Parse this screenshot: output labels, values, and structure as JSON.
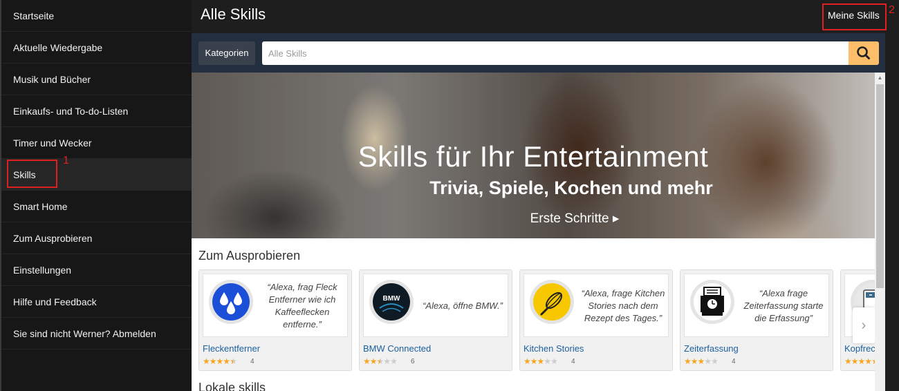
{
  "sidebar": {
    "items": [
      {
        "label": "Startseite"
      },
      {
        "label": "Aktuelle Wiedergabe"
      },
      {
        "label": "Musik und Bücher"
      },
      {
        "label": "Einkaufs- und To-do-Listen"
      },
      {
        "label": "Timer und Wecker"
      },
      {
        "label": "Skills",
        "active": true
      },
      {
        "label": "Smart Home"
      },
      {
        "label": "Zum Ausprobieren"
      },
      {
        "label": "Einstellungen"
      },
      {
        "label": "Hilfe und Feedback"
      },
      {
        "label": "Sie sind nicht Werner? Abmelden"
      }
    ]
  },
  "header": {
    "title": "Alle Skills",
    "my_skills": "Meine Skills"
  },
  "search": {
    "categories_label": "Kategorien",
    "placeholder": "Alle Skills"
  },
  "banner": {
    "title": "Skills für Ihr Entertainment",
    "subtitle": "Trivia, Spiele, Kochen und mehr",
    "cta": "Erste Schritte ▸"
  },
  "section": {
    "title": "Zum Ausprobieren",
    "cards": [
      {
        "name": "Fleckentferner",
        "quote": "“Alexa, frag Fleck Entferner wie ich Kaffeeflecken entferne.”",
        "rating": 4.5,
        "count": "4",
        "icon": "water-drops-icon"
      },
      {
        "name": "BMW Connected",
        "quote": "“Alexa, öffne BMW.”",
        "rating": 2.5,
        "count": "6",
        "icon": "bmw-logo-icon"
      },
      {
        "name": "Kitchen Stories",
        "quote": "“Alexa, frage Kitchen Stories nach dem Rezept des Tages.”",
        "rating": 3,
        "count": "4",
        "icon": "whisk-icon"
      },
      {
        "name": "Zeiterfassung",
        "quote": "“Alexa frage Zeiterfassung starte die Erfassung”",
        "rating": 3,
        "count": "4",
        "icon": "time-clock-icon"
      },
      {
        "name": "Kopfrec",
        "quote": "",
        "rating": 4.5,
        "count": "",
        "icon": "calculator-icon"
      }
    ]
  },
  "section2": {
    "title": "Lokale skills"
  },
  "annotations": {
    "mark1": "1",
    "mark2": "2"
  },
  "colors": {
    "accent": "#febd69",
    "star": "#f5a623",
    "link": "#1a5f9e",
    "annotation": "#e02020"
  }
}
